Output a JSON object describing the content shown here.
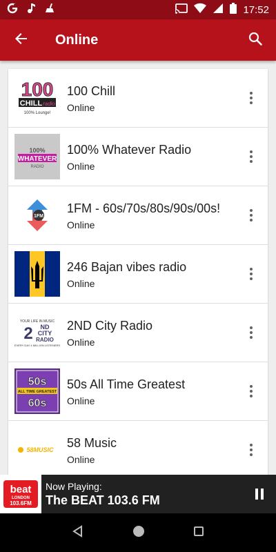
{
  "status_bar": {
    "time": "17:52",
    "icons": [
      "google-icon",
      "music-note-icon",
      "cleaner-icon",
      "cast-icon",
      "wifi-icon",
      "signal-icon",
      "battery-icon"
    ]
  },
  "app_bar": {
    "title": "Online",
    "back_icon": "arrow-back-icon",
    "search_icon": "search-icon"
  },
  "stations": [
    {
      "name": "100 Chill",
      "status": "Online",
      "logo_text": "100",
      "logo_subtext": "CHILL"
    },
    {
      "name": "100% Whatever Radio",
      "status": "Online",
      "logo_text": "100%",
      "logo_subtext": "WHATEVER"
    },
    {
      "name": "1FM - 60s/70s/80s/90s/00s!",
      "status": "Online",
      "logo_text": "1FM",
      "logo_subtext": ""
    },
    {
      "name": "246 Bajan vibes radio",
      "status": "Online",
      "logo_text": "",
      "logo_subtext": ""
    },
    {
      "name": "2ND City Radio",
      "status": "Online",
      "logo_text": "2ND",
      "logo_subtext": "CITY RADIO"
    },
    {
      "name": "50s All Time Greatest",
      "status": "Online",
      "logo_text": "50s",
      "logo_subtext": "60s"
    },
    {
      "name": "58 Music",
      "status": "Online",
      "logo_text": "58MUSIC",
      "logo_subtext": ""
    }
  ],
  "now_playing": {
    "label": "Now Playing:",
    "title": "The BEAT 103.6 FM",
    "logo_text": "beat",
    "logo_subtext": "103.6FM"
  },
  "colors": {
    "status_bar": "#8e0c15",
    "app_bar": "#b5121b",
    "now_playing_bg": "#212121"
  }
}
